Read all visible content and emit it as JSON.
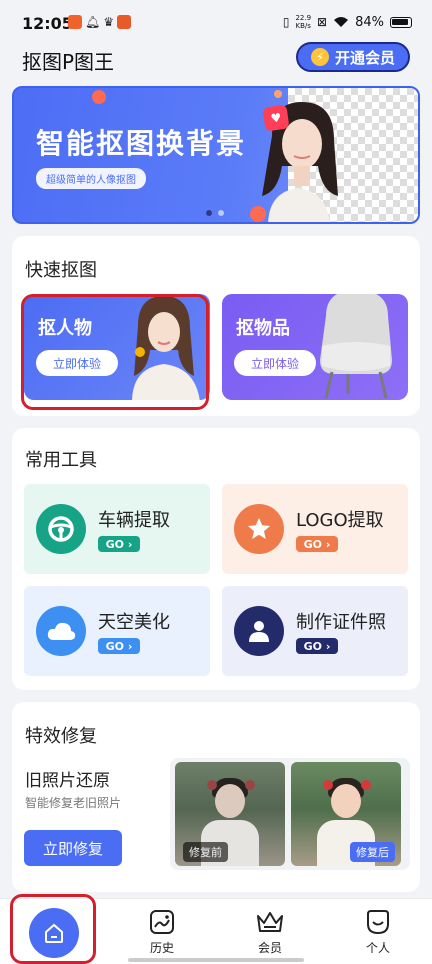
{
  "status_bar": {
    "time": "12:05",
    "speed_value": "22.9",
    "speed_unit": "KB/s",
    "battery": "84%"
  },
  "header": {
    "app_title": "抠图P图王",
    "vip_button": "开通会员"
  },
  "banner": {
    "title": "智能抠图换背景",
    "subtitle": "超级简单的人像抠图",
    "page_count": 2,
    "active_page": 0
  },
  "quick_cutout": {
    "title": "快速抠图",
    "tiles": [
      {
        "label": "抠人物",
        "button": "立即体验"
      },
      {
        "label": "抠物品",
        "button": "立即体验"
      }
    ]
  },
  "tools": {
    "title": "常用工具",
    "items": [
      {
        "name": "车辆提取",
        "go": "GO",
        "icon": "steering-wheel-icon",
        "color": "#17a386",
        "bg": "#e6f6f1"
      },
      {
        "name": "LOGO提取",
        "go": "GO",
        "icon": "star-icon",
        "color": "#f07b4a",
        "bg": "#fdeee6"
      },
      {
        "name": "天空美化",
        "go": "GO",
        "icon": "cloud-icon",
        "color": "#3d8ff2",
        "bg": "#e8f1fd"
      },
      {
        "name": "制作证件照",
        "go": "GO",
        "icon": "person-icon",
        "color": "#232b6b",
        "bg": "#eceffa"
      }
    ]
  },
  "repair": {
    "title": "特效修复",
    "name": "旧照片还原",
    "desc": "智能修复老旧照片",
    "button": "立即修复",
    "before_label": "修复前",
    "after_label": "修复后"
  },
  "bottom_nav": {
    "items": [
      {
        "label": "",
        "icon": "home-icon"
      },
      {
        "label": "历史",
        "icon": "history-icon"
      },
      {
        "label": "会员",
        "icon": "crown-icon"
      },
      {
        "label": "个人",
        "icon": "profile-icon"
      }
    ]
  },
  "colors": {
    "accent": "#4a6df4",
    "highlight": "#d4202c"
  }
}
